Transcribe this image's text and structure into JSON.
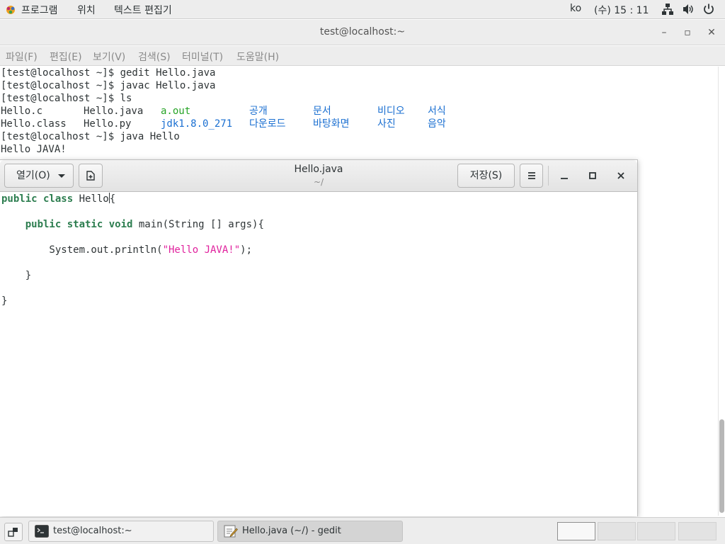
{
  "topbar": {
    "apps": "프로그램",
    "places": "위치",
    "app_name": "텍스트 편집기",
    "lang": "ko",
    "clock": "(수) 15 : 11"
  },
  "terminal": {
    "title": "test@localhost:~",
    "menu": [
      "파일(F)",
      "편집(E)",
      "보기(V)",
      "검색(S)",
      "터미널(T)",
      "도움말(H)"
    ],
    "lines": [
      "[test@localhost ~]$ gedit Hello.java",
      "[test@localhost ~]$ javac Hello.java",
      "[test@localhost ~]$ ls",
      "[test@localhost ~]$ java Hello",
      "Hello JAVA!"
    ],
    "ls_row1": [
      "Hello.c",
      "Hello.java",
      "a.out",
      "공개",
      "문서",
      "비디오",
      "서식"
    ],
    "ls_row2": [
      "Hello.class",
      "Hello.py",
      "jdk1.8.0_271",
      "다운로드",
      "바탕화면",
      "사진",
      "음악"
    ],
    "colors": {
      "directory": "#1a6fd1",
      "executable": "#26a326",
      "text": "#2e3436"
    }
  },
  "gedit": {
    "open_label": "열기(O)",
    "title": "Hello.java",
    "subtitle": "~/",
    "save_label": "저장(S)",
    "code": {
      "l1_kw": "public class",
      "l1_rest": " Hello",
      "l1_brace": "{",
      "l2_indent": "    ",
      "l2_kw": "public static void",
      "l2_rest": " main(String [] args){",
      "l3_head": "        System.out.println(",
      "l3_str": "\"Hello JAVA!\"",
      "l3_tail": ");",
      "l4": "    }",
      "l5": "}"
    },
    "colors": {
      "keyword": "#2c7d4f",
      "string": "#e0219d"
    }
  },
  "taskbar": {
    "tasks": [
      "test@localhost:~",
      "Hello.java (~/) - gedit"
    ]
  }
}
